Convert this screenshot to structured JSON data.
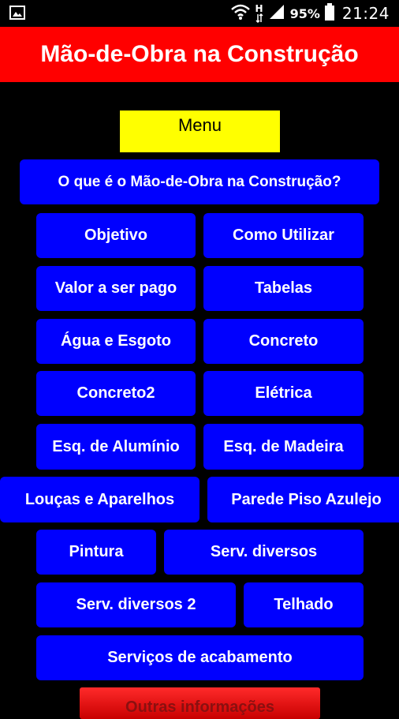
{
  "status_bar": {
    "battery": "95%",
    "time": "21:24",
    "left_icon": "image-notification-icon",
    "wifi_icon": "wifi-icon",
    "network_label": "H",
    "signal_icon": "signal-icon",
    "battery_icon": "battery-icon"
  },
  "app": {
    "title": "Mão-de-Obra na Construção"
  },
  "menu": {
    "label": "Menu",
    "what_is": "O que é o Mão-de-Obra na Construção?",
    "objetivo": "Objetivo",
    "como_utilizar": "Como Utilizar",
    "valor": "Valor a ser pago",
    "tabelas": "Tabelas",
    "agua": "Água e Esgoto",
    "concreto": "Concreto",
    "concreto2": "Concreto2",
    "eletrica": "Elétrica",
    "esq_aluminio": "Esq. de Alumínio",
    "esq_madeira": "Esq. de Madeira",
    "loucas": "Louças e Aparelhos",
    "parede": "Parede Piso Azulejo",
    "pintura": "Pintura",
    "serv_diversos": "Serv. diversos",
    "serv_diversos2": "Serv. diversos 2",
    "telhado": "Telhado",
    "acabamento": "Serviços de acabamento",
    "outras": "Outras informações"
  },
  "colors": {
    "title_bar": "#ff0000",
    "menu_label_bg": "#ffff00",
    "button_bg": "#0000ff",
    "background": "#000000"
  }
}
